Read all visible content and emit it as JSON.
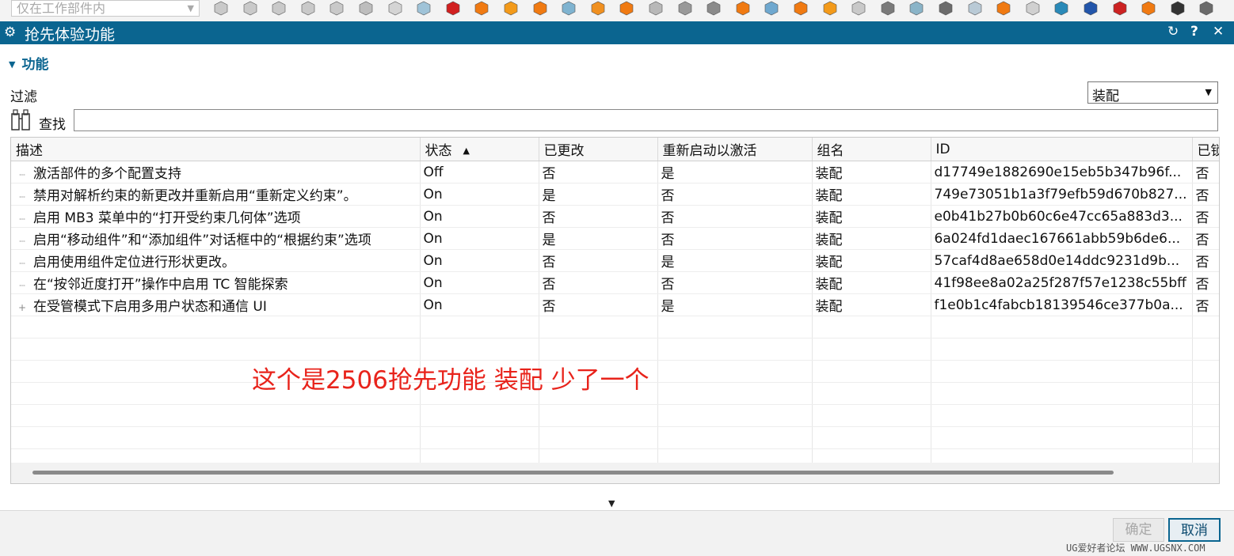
{
  "toolbar": {
    "filter_value": "仅在工作部件内",
    "icons": [
      "face-select-icon",
      "feature-icon",
      "curve-select-icon",
      "snap-icon",
      "body-icon",
      "point-snap-icon",
      "block-icon",
      "block-cube-icon",
      "no-entry-icon",
      "orange-box-icon",
      "orange-sheet-icon",
      "shaded-box-icon",
      "plane-icon",
      "orange-face-icon",
      "layers-icon",
      "cylinder-icon",
      "assembly-icon",
      "pipe-icon",
      "orange-solid-icon",
      "sheet-icon",
      "orange-tile-icon",
      "orange-curve-icon",
      "gray-face-icon",
      "section-icon",
      "edge-icon",
      "triangle-view-icon",
      "sphere-icon",
      "stack-icon",
      "cube-icon",
      "spline-icon",
      "datum-icon",
      "csys-icon",
      "orange-block-icon",
      "frame-icon",
      "view-icon"
    ]
  },
  "dialog": {
    "title": "抢先体验功能",
    "reset_glyph": "↻",
    "help_glyph": "?",
    "close_glyph": "✕"
  },
  "section": {
    "title": "功能",
    "filter_label": "过滤",
    "filter_selected": "装配",
    "search_label": "查找",
    "search_value": ""
  },
  "table": {
    "columns": [
      "描述",
      "状态",
      "已更改",
      "重新启动以激活",
      "组名",
      "ID",
      "已锁"
    ],
    "sort_column": "状态",
    "rows": [
      {
        "tree": "┈",
        "desc": "激活部件的多个配置支持",
        "status": "Off",
        "changed": "否",
        "restart": "是",
        "group": "装配",
        "id": "d17749e1882690e15eb5b347b96f...",
        "locked": "否"
      },
      {
        "tree": "┈",
        "desc": "禁用对解析约束的新更改并重新启用“重新定义约束”。",
        "status": "On",
        "changed": "是",
        "restart": "否",
        "group": "装配",
        "id": "749e73051b1a3f79efb59d670b827...",
        "locked": "否"
      },
      {
        "tree": "┈",
        "desc": "启用 MB3 菜单中的“打开受约束几何体”选项",
        "status": "On",
        "changed": "否",
        "restart": "否",
        "group": "装配",
        "id": "e0b41b27b0b60c6e47cc65a883d3...",
        "locked": "否"
      },
      {
        "tree": "┈",
        "desc": "启用“移动组件”和“添加组件”对话框中的“根据约束”选项",
        "status": "On",
        "changed": "是",
        "restart": "否",
        "group": "装配",
        "id": "6a024fd1daec167661abb59b6de6...",
        "locked": "否"
      },
      {
        "tree": "┈",
        "desc": "启用使用组件定位进行形状更改。",
        "status": "On",
        "changed": "否",
        "restart": "是",
        "group": "装配",
        "id": "57caf4d8ae658d0e14ddc9231d9b...",
        "locked": "否"
      },
      {
        "tree": "┈",
        "desc": "在“按邻近度打开”操作中启用 TC 智能探索",
        "status": "On",
        "changed": "否",
        "restart": "否",
        "group": "装配",
        "id": "41f98ee8a02a25f287f57e1238c55bff",
        "locked": "否"
      },
      {
        "tree": "+",
        "desc": "在受管模式下启用多用户状态和通信 UI",
        "status": "On",
        "changed": "否",
        "restart": "是",
        "group": "装配",
        "id": "f1e0b1c4fabcb18139546ce377b0a...",
        "locked": "否"
      }
    ]
  },
  "annotation": "这个是2506抢先功能 装配 少了一个",
  "footer": {
    "ok_label": "确定",
    "cancel_label": "取消",
    "watermark": "UG爱好者论坛 WWW.UGSNX.COM"
  }
}
